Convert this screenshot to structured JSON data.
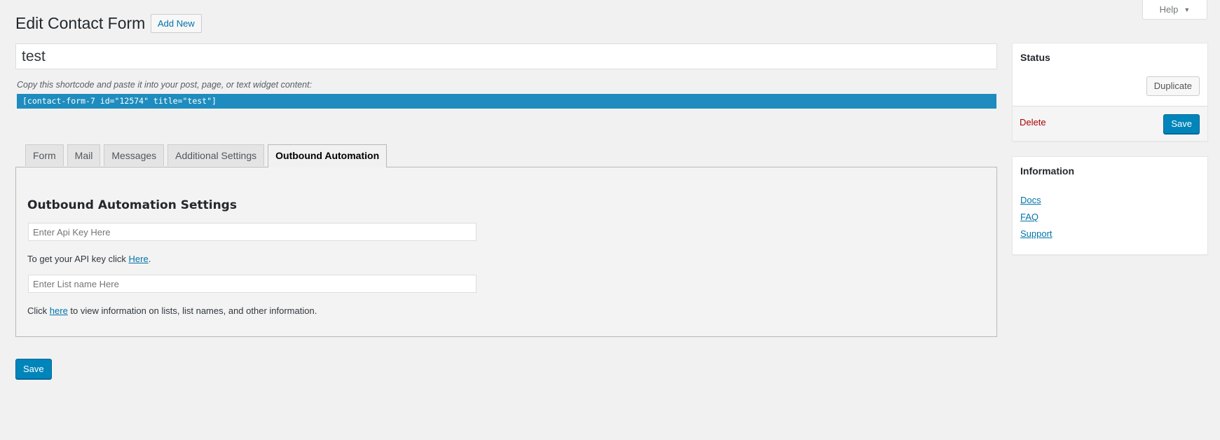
{
  "help_tab": {
    "label": "Help"
  },
  "header": {
    "title": "Edit Contact Form",
    "add_new_label": "Add New"
  },
  "form_title": {
    "value": "test"
  },
  "shortcode": {
    "label": "Copy this shortcode and paste it into your post, page, or text widget content:",
    "code": "[contact-form-7 id=\"12574\" title=\"test\"]"
  },
  "tabs": [
    {
      "label": "Form",
      "active": false
    },
    {
      "label": "Mail",
      "active": false
    },
    {
      "label": "Messages",
      "active": false
    },
    {
      "label": "Additional Settings",
      "active": false
    },
    {
      "label": "Outbound Automation",
      "active": true
    }
  ],
  "panel": {
    "heading": "Outbound Automation Settings",
    "api_key": {
      "placeholder": "Enter Api Key Here",
      "value": ""
    },
    "api_help": {
      "prefix": "To get your API key click ",
      "link": "Here",
      "suffix": "."
    },
    "list_name": {
      "placeholder": "Enter List name Here",
      "value": ""
    },
    "list_help": {
      "prefix": "Click ",
      "link": "here",
      "suffix": " to view information on lists, list names, and other information."
    }
  },
  "save_label": "Save",
  "status_box": {
    "title": "Status",
    "duplicate_label": "Duplicate",
    "delete_label": "Delete",
    "save_label": "Save"
  },
  "info_box": {
    "title": "Information",
    "links": [
      "Docs",
      "FAQ",
      "Support"
    ]
  },
  "colors": {
    "accent": "#0085ba",
    "link": "#0073aa",
    "shortcode_bg": "#1e8cbe",
    "delete": "#aa0000"
  }
}
